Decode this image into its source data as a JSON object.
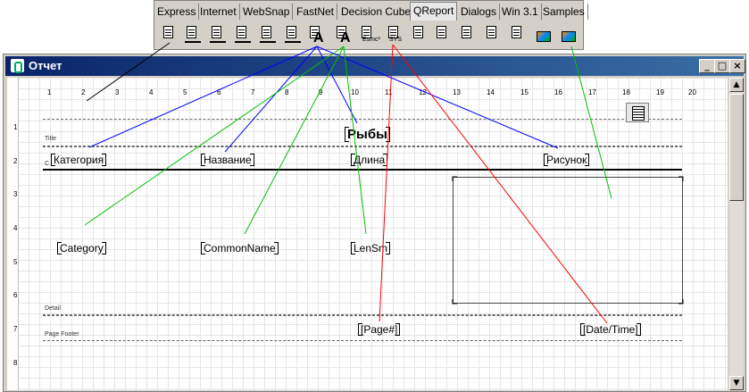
{
  "palette": {
    "tabs": [
      "Express",
      "Internet",
      "WebSnap",
      "FastNet",
      "Decision Cube",
      "QReport",
      "Dialogs",
      "Win 3.1",
      "Samples"
    ],
    "active_tab": "QReport",
    "tool_labels": {
      "qrexpr": "Esmc²",
      "qrsysdata": "SYS"
    }
  },
  "window": {
    "title": "Отчет",
    "btn_min": "_",
    "btn_max": "□",
    "btn_close": "×"
  },
  "ruler": {
    "h": [
      "1",
      "2",
      "3",
      "4",
      "5",
      "6",
      "7",
      "8",
      "9",
      "10",
      "11",
      "12",
      "13",
      "14",
      "15",
      "16",
      "17",
      "18",
      "19",
      "20"
    ],
    "v": [
      "1",
      "2",
      "3",
      "4",
      "5",
      "6",
      "7",
      "8"
    ]
  },
  "bands": {
    "title": "Title",
    "detail": "Detail",
    "footer": "Page Footer",
    "colheader": "C"
  },
  "report": {
    "title_label": "Рыбы",
    "header_labels": [
      "Категория",
      "Название",
      "Длина",
      "Рисунок"
    ],
    "detail_fields": [
      "Category",
      "CommonName",
      "LenSm"
    ],
    "footer_page": "[Page#]",
    "footer_datetime": "[Date/Time]"
  },
  "scroll": {
    "up": "▲",
    "down": "▼"
  }
}
